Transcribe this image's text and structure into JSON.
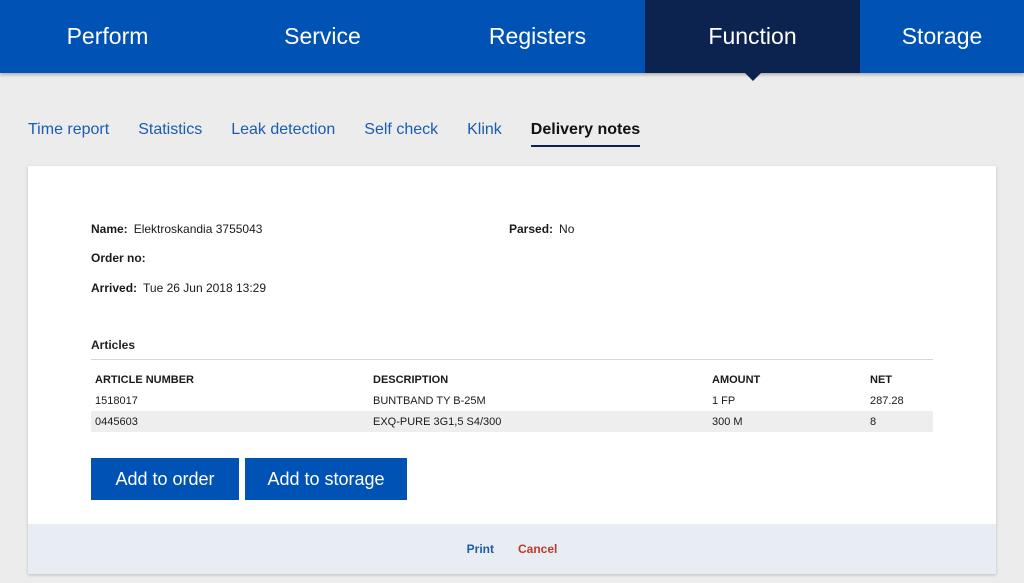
{
  "topnav": {
    "items": [
      {
        "label": "Perform",
        "active": false
      },
      {
        "label": "Service",
        "active": false
      },
      {
        "label": "Registers",
        "active": false
      },
      {
        "label": "Function",
        "active": true
      },
      {
        "label": "Storage",
        "active": false
      }
    ]
  },
  "subnav": {
    "items": [
      {
        "label": "Time report",
        "active": false
      },
      {
        "label": "Statistics",
        "active": false
      },
      {
        "label": "Leak detection",
        "active": false
      },
      {
        "label": "Self check",
        "active": false
      },
      {
        "label": "Klink",
        "active": false
      },
      {
        "label": "Delivery notes",
        "active": true
      }
    ]
  },
  "details": {
    "name_label": "Name:",
    "name_value": "Elektroskandia 3755043",
    "parsed_label": "Parsed:",
    "parsed_value": "No",
    "order_label": "Order no:",
    "order_value": "",
    "arrived_label": "Arrived:",
    "arrived_value": "Tue 26 Jun 2018 13:29"
  },
  "articles": {
    "title": "Articles",
    "columns": [
      "ARTICLE NUMBER",
      "DESCRIPTION",
      "AMOUNT",
      "NET"
    ],
    "rows": [
      [
        "1518017",
        "BUNTBAND TY B-25M",
        "1 FP",
        "287.28"
      ],
      [
        "0445603",
        "EXQ-PURE 3G1,5 S4/300",
        "300 M",
        "8"
      ]
    ]
  },
  "actions": {
    "add_to_order": "Add to order",
    "add_to_storage": "Add to storage"
  },
  "footer": {
    "print": "Print",
    "cancel": "Cancel"
  },
  "colors": {
    "brand_blue": "#0052b4",
    "active_nav": "#0c2350",
    "cancel_red": "#c0392b"
  }
}
